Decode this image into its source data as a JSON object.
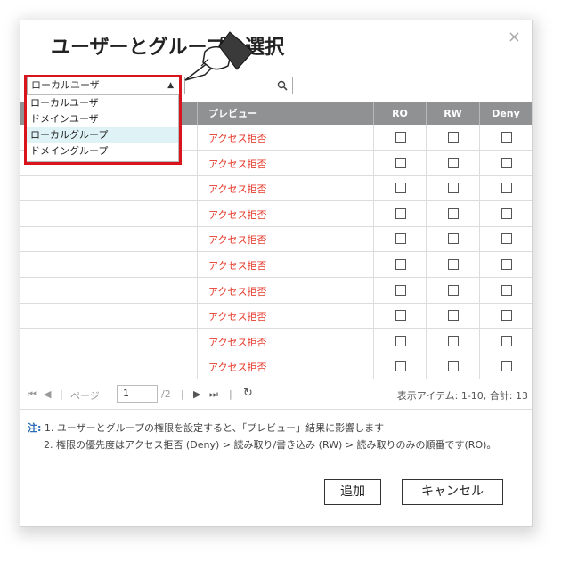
{
  "dialog": {
    "title": "ユーザーとグループの選択",
    "close_glyph": "×"
  },
  "filter": {
    "selected": "ローカルユーザ",
    "caret": "▲",
    "search_placeholder": "",
    "search_icon": "search-icon"
  },
  "dropdown": {
    "options": [
      "ローカルユーザ",
      "ドメインユーザ",
      "ローカルグループ",
      "ドメイングループ"
    ],
    "highlighted_index": 2
  },
  "table": {
    "columns": [
      "",
      "プレビュー",
      "RO",
      "RW",
      "Deny"
    ],
    "rows": [
      {
        "preview": "アクセス拒否"
      },
      {
        "preview": "アクセス拒否"
      },
      {
        "preview": "アクセス拒否"
      },
      {
        "preview": "アクセス拒否"
      },
      {
        "preview": "アクセス拒否"
      },
      {
        "preview": "アクセス拒否"
      },
      {
        "preview": "アクセス拒否"
      },
      {
        "preview": "アクセス拒否"
      },
      {
        "preview": "アクセス拒否"
      },
      {
        "preview": "アクセス拒否"
      }
    ]
  },
  "pager": {
    "page_label": "ページ",
    "current_page": "1",
    "total_pages": "/2",
    "summary": "表示アイテム: 1-10, 合計: 13"
  },
  "notes": {
    "label": "注:",
    "line1": "1. ユーザーとグループの権限を設定すると、「プレビュー」結果に影響します",
    "line2": "2. 権限の優先度はアクセス拒否 (Deny) > 読み取り/書き込み (RW) > 読み取りのみの順番です(RO)。"
  },
  "buttons": {
    "add": "追加",
    "cancel": "キャンセル"
  },
  "colors": {
    "header_bg": "#8f9193",
    "deny_text": "#e53a2b",
    "highlight_border": "#d8151d",
    "selected_option_bg": "#dff3f7"
  }
}
